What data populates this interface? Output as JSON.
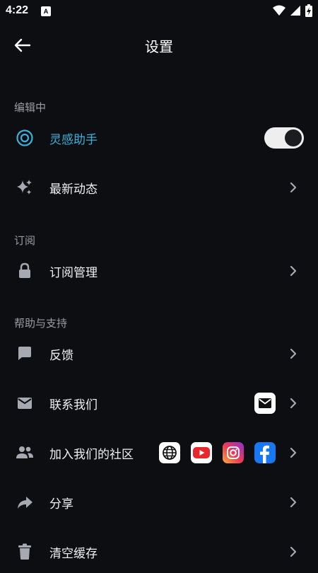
{
  "statusbar": {
    "time": "4:22",
    "badge": "A"
  },
  "header": {
    "title": "设置"
  },
  "sections": {
    "editing": "编辑中",
    "subscription": "订阅",
    "help": "帮助与支持"
  },
  "items": {
    "inspiration": {
      "label": "灵感助手",
      "toggle_on": true,
      "accent": "#3cb0d9"
    },
    "whats_new": {
      "label": "最新动态"
    },
    "subscription_mgmt": {
      "label": "订阅管理"
    },
    "feedback": {
      "label": "反馈"
    },
    "contact_us": {
      "label": "联系我们"
    },
    "join_community": {
      "label": "加入我们的社区"
    },
    "share": {
      "label": "分享"
    },
    "clear_cache": {
      "label": "清空缓存"
    }
  },
  "icons": {
    "inspiration": "target-icon",
    "whats_new": "sparkle-icon",
    "subscription": "lock-icon",
    "feedback": "chat-bubble-icon",
    "contact": "mail-icon",
    "community": "people-icon",
    "share": "share-arrow-icon",
    "clear": "trash-icon"
  },
  "colors": {
    "background": "#0d0e11",
    "section_label": "#9a9ca3",
    "accent": "#3cb0d9",
    "icon_grey": "#a7a9b2"
  }
}
